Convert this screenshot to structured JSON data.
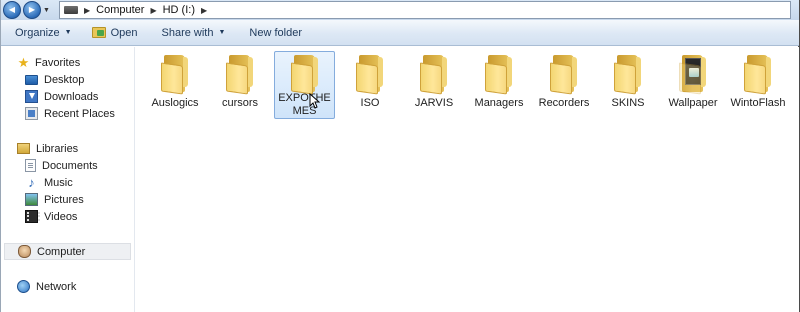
{
  "address": {
    "back_glyph": "◀",
    "forward_glyph": "▶",
    "dropdown_glyph": "▼",
    "crumbs": [
      "Computer",
      "HD (I:)"
    ],
    "separator": "▶"
  },
  "toolbar": {
    "organize": "Organize",
    "open": "Open",
    "share_with": "Share with",
    "new_folder": "New folder",
    "caret": "▼"
  },
  "nav": {
    "favorites": "Favorites",
    "desktop": "Desktop",
    "downloads": "Downloads",
    "recent_places": "Recent Places",
    "libraries": "Libraries",
    "documents": "Documents",
    "music": "Music",
    "pictures": "Pictures",
    "videos": "Videos",
    "computer": "Computer",
    "network": "Network",
    "star_glyph": "★",
    "music_glyph": "♪"
  },
  "folders": [
    {
      "name": "Auslogics"
    },
    {
      "name": "cursors"
    },
    {
      "name": "EXPOTHEMES"
    },
    {
      "name": "ISO"
    },
    {
      "name": "JARVIS"
    },
    {
      "name": "Managers"
    },
    {
      "name": "Recorders"
    },
    {
      "name": "SKINS"
    },
    {
      "name": "Wallpaper"
    },
    {
      "name": "WintoFlash"
    }
  ],
  "selected_folder": "EXPOTHEMES",
  "colors": {
    "selection_bg": "#cfe4fa",
    "selection_border": "#84acdd",
    "toolbar_text": "#1e395b"
  }
}
